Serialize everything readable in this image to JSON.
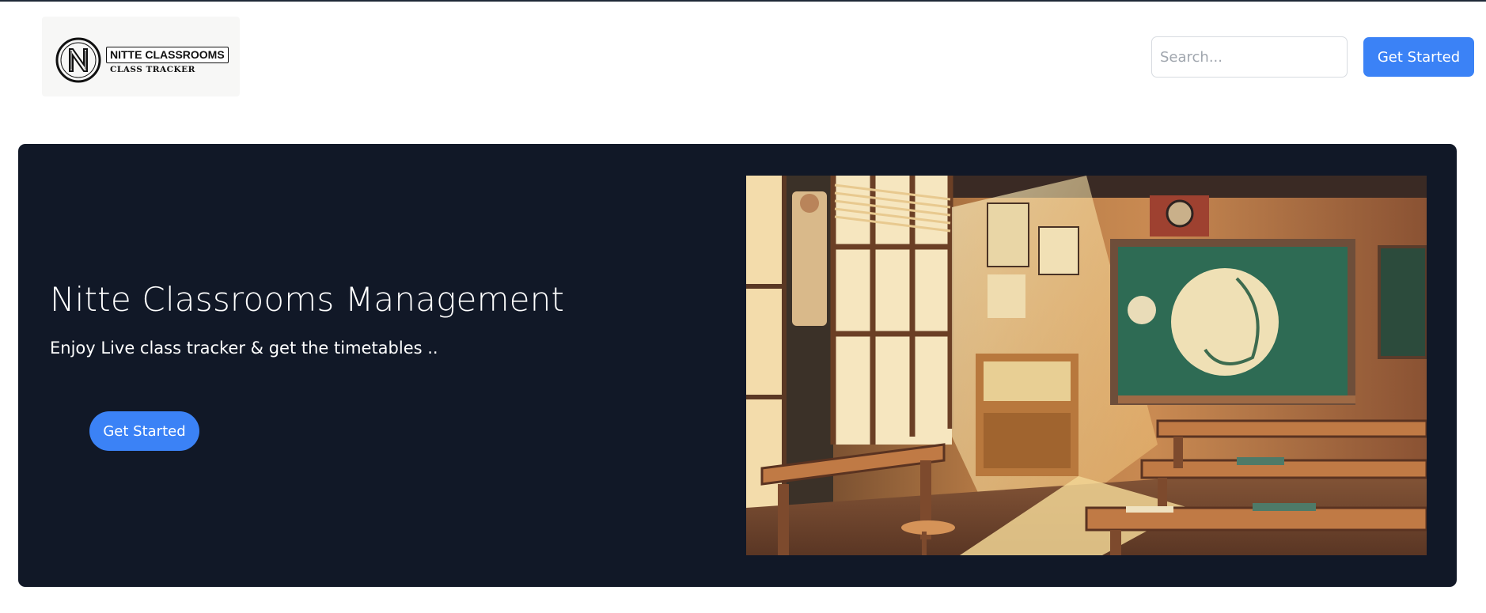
{
  "header": {
    "logo": {
      "title": "NITTE CLASSROOMS",
      "subtitle": "CLASS TRACKER",
      "icon": "n-monogram-icon"
    },
    "search": {
      "placeholder": "Search...",
      "value": ""
    },
    "cta_label": "Get Started"
  },
  "hero": {
    "title": "Nitte Classrooms Management",
    "subtitle": "Enjoy Live class tracker & get the timetables ..",
    "cta_label": "Get Started",
    "image": "classroom-illustration"
  },
  "colors": {
    "accent": "#3b82f6",
    "hero_bg": "#111827",
    "page_bg": "#ffffff"
  }
}
